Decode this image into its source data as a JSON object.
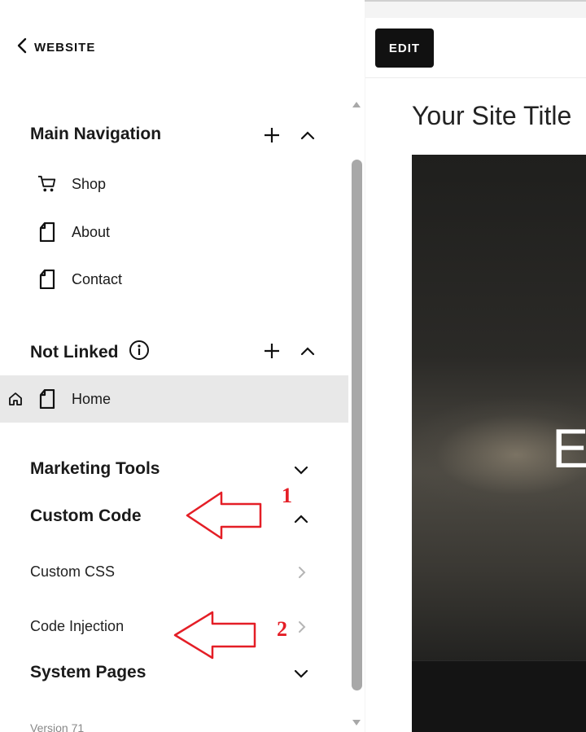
{
  "header": {
    "back_label": "WEBSITE"
  },
  "main_navigation": {
    "title": "Main Navigation",
    "items": [
      {
        "label": "Shop",
        "icon": "cart-icon"
      },
      {
        "label": "About",
        "icon": "page-icon"
      },
      {
        "label": "Contact",
        "icon": "page-icon"
      }
    ]
  },
  "not_linked": {
    "title": "Not Linked",
    "items": [
      {
        "label": "Home",
        "icon": "page-icon",
        "selected": true,
        "homepage": true
      }
    ]
  },
  "marketing_tools": {
    "title": "Marketing Tools"
  },
  "custom_code": {
    "title": "Custom Code",
    "items": [
      {
        "label": "Custom CSS"
      },
      {
        "label": "Code Injection"
      }
    ]
  },
  "system_pages": {
    "title": "System Pages"
  },
  "footer": {
    "version": "Version 71"
  },
  "annotations": [
    {
      "number": "1"
    },
    {
      "number": "2"
    }
  ],
  "preview": {
    "edit_label": "EDIT",
    "site_title": "Your Site Title",
    "hero_text": "E"
  },
  "colors": {
    "annotation": "#e41e26",
    "selected_row": "#e8e8e8",
    "edit_button": "#111111"
  }
}
